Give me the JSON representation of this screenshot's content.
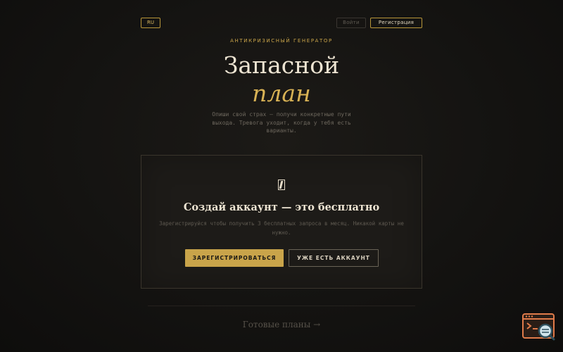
{
  "header": {
    "lang_label": "RU",
    "login_label": "Войти",
    "register_label": "Регистрация"
  },
  "hero": {
    "eyebrow": "АНТИКРИЗИСНЫЙ ГЕНЕРАТОР",
    "title_main": "Запасной",
    "title_accent": "план",
    "subtitle": "Опиши свой страх — получи конкретные пути выхода. Тревога уходит, когда у тебя есть варианты."
  },
  "card": {
    "icon": "pencil-icon",
    "title": "Создай аккаунт — это бесплатно",
    "text": "Зарегистрируйся чтобы получить 3 бесплатных запроса в месяц. Никакой карты не нужно.",
    "primary_label": "ЗАРЕГИСТРИРОВАТЬСЯ",
    "secondary_label": "УЖЕ ЕСТЬ АККАУНТ"
  },
  "footer": {
    "ready_plans_label": "Готовые планы →"
  },
  "widget": {
    "icon": "console-search-icon"
  },
  "colors": {
    "accent": "#c9a44a",
    "background": "#121110",
    "card": "#1d1b18",
    "text_light": "#ede4d2",
    "widget_orange": "#e07b4a"
  }
}
